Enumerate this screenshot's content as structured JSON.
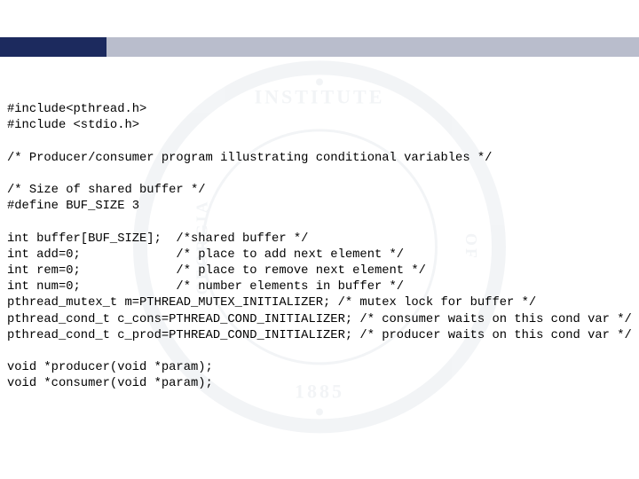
{
  "watermark": {
    "top": "INSTITUTE",
    "left": "GEORGIA",
    "right": "OF",
    "bottom": "1885"
  },
  "code": {
    "l1": "#include<pthread.h>",
    "l2": "#include <stdio.h>",
    "l3": "",
    "l4": "/* Producer/consumer program illustrating conditional variables */",
    "l5": "",
    "l6": "/* Size of shared buffer */",
    "l7": "#define BUF_SIZE 3",
    "l8": "",
    "l9": "int buffer[BUF_SIZE];  /*shared buffer */",
    "l10": "int add=0;             /* place to add next element */",
    "l11": "int rem=0;             /* place to remove next element */",
    "l12": "int num=0;             /* number elements in buffer */",
    "l13": "pthread_mutex_t m=PTHREAD_MUTEX_INITIALIZER; /* mutex lock for buffer */",
    "l14": "pthread_cond_t c_cons=PTHREAD_COND_INITIALIZER; /* consumer waits on this cond var */",
    "l15": "pthread_cond_t c_prod=PTHREAD_COND_INITIALIZER; /* producer waits on this cond var */",
    "l16": "",
    "l17": "void *producer(void *param);",
    "l18": "void *consumer(void *param);"
  }
}
